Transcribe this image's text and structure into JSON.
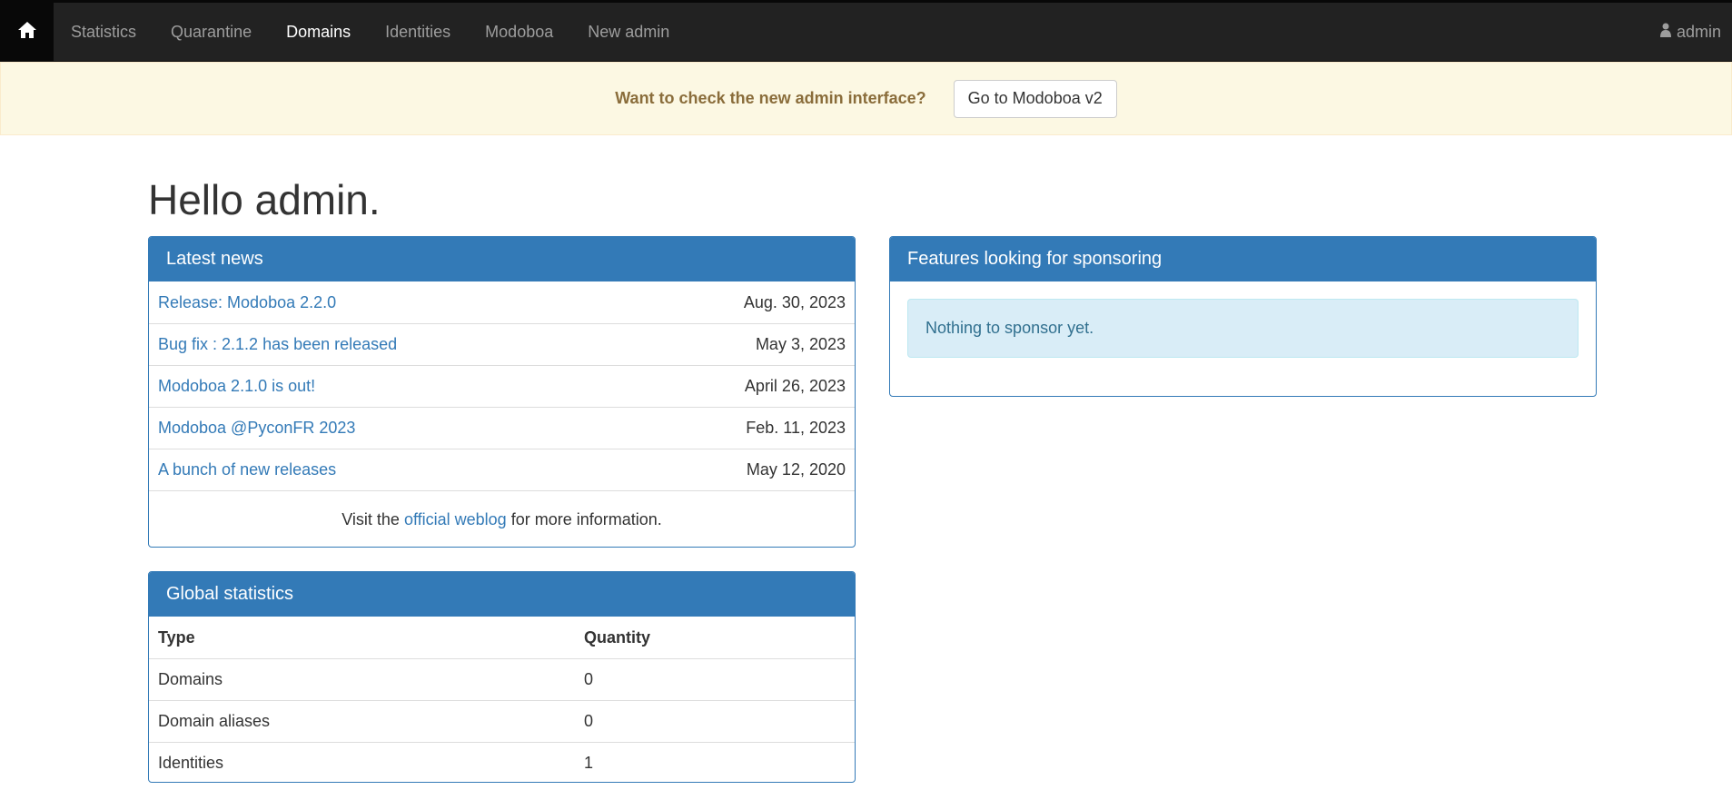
{
  "navbar": {
    "home_icon": "home-icon",
    "items": [
      {
        "label": "Statistics",
        "active": false
      },
      {
        "label": "Quarantine",
        "active": false
      },
      {
        "label": "Domains",
        "active": true
      },
      {
        "label": "Identities",
        "active": false
      },
      {
        "label": "Modoboa",
        "active": false
      },
      {
        "label": "New admin",
        "active": false
      }
    ],
    "user_icon": "user-icon",
    "user_label": "admin"
  },
  "banner": {
    "text": "Want to check the new admin interface?",
    "button_label": "Go to Modoboa v2"
  },
  "page_title": "Hello admin.",
  "news": {
    "title": "Latest news",
    "items": [
      {
        "title": "Release: Modoboa 2.2.0",
        "date": "Aug. 30, 2023"
      },
      {
        "title": "Bug fix : 2.1.2 has been released",
        "date": "May 3, 2023"
      },
      {
        "title": "Modoboa 2.1.0 is out!",
        "date": "April 26, 2023"
      },
      {
        "title": "Modoboa @PyconFR 2023",
        "date": "Feb. 11, 2023"
      },
      {
        "title": "A bunch of new releases",
        "date": "May 12, 2020"
      }
    ],
    "footer_prefix": "Visit the",
    "footer_link": "official weblog",
    "footer_suffix": "for more information."
  },
  "sponsoring": {
    "title": "Features looking for sponsoring",
    "empty_message": "Nothing to sponsor yet."
  },
  "stats": {
    "title": "Global statistics",
    "columns": [
      "Type",
      "Quantity"
    ],
    "rows": [
      {
        "type": "Domains",
        "quantity": "0"
      },
      {
        "type": "Domain aliases",
        "quantity": "0"
      },
      {
        "type": "Identities",
        "quantity": "1"
      }
    ]
  },
  "colors": {
    "navbar_bg": "#222222",
    "primary": "#337ab7",
    "warning_bg": "#fcf8e3",
    "warning_text": "#8a6d3b",
    "info_bg": "#d9edf7",
    "info_text": "#31708f"
  }
}
